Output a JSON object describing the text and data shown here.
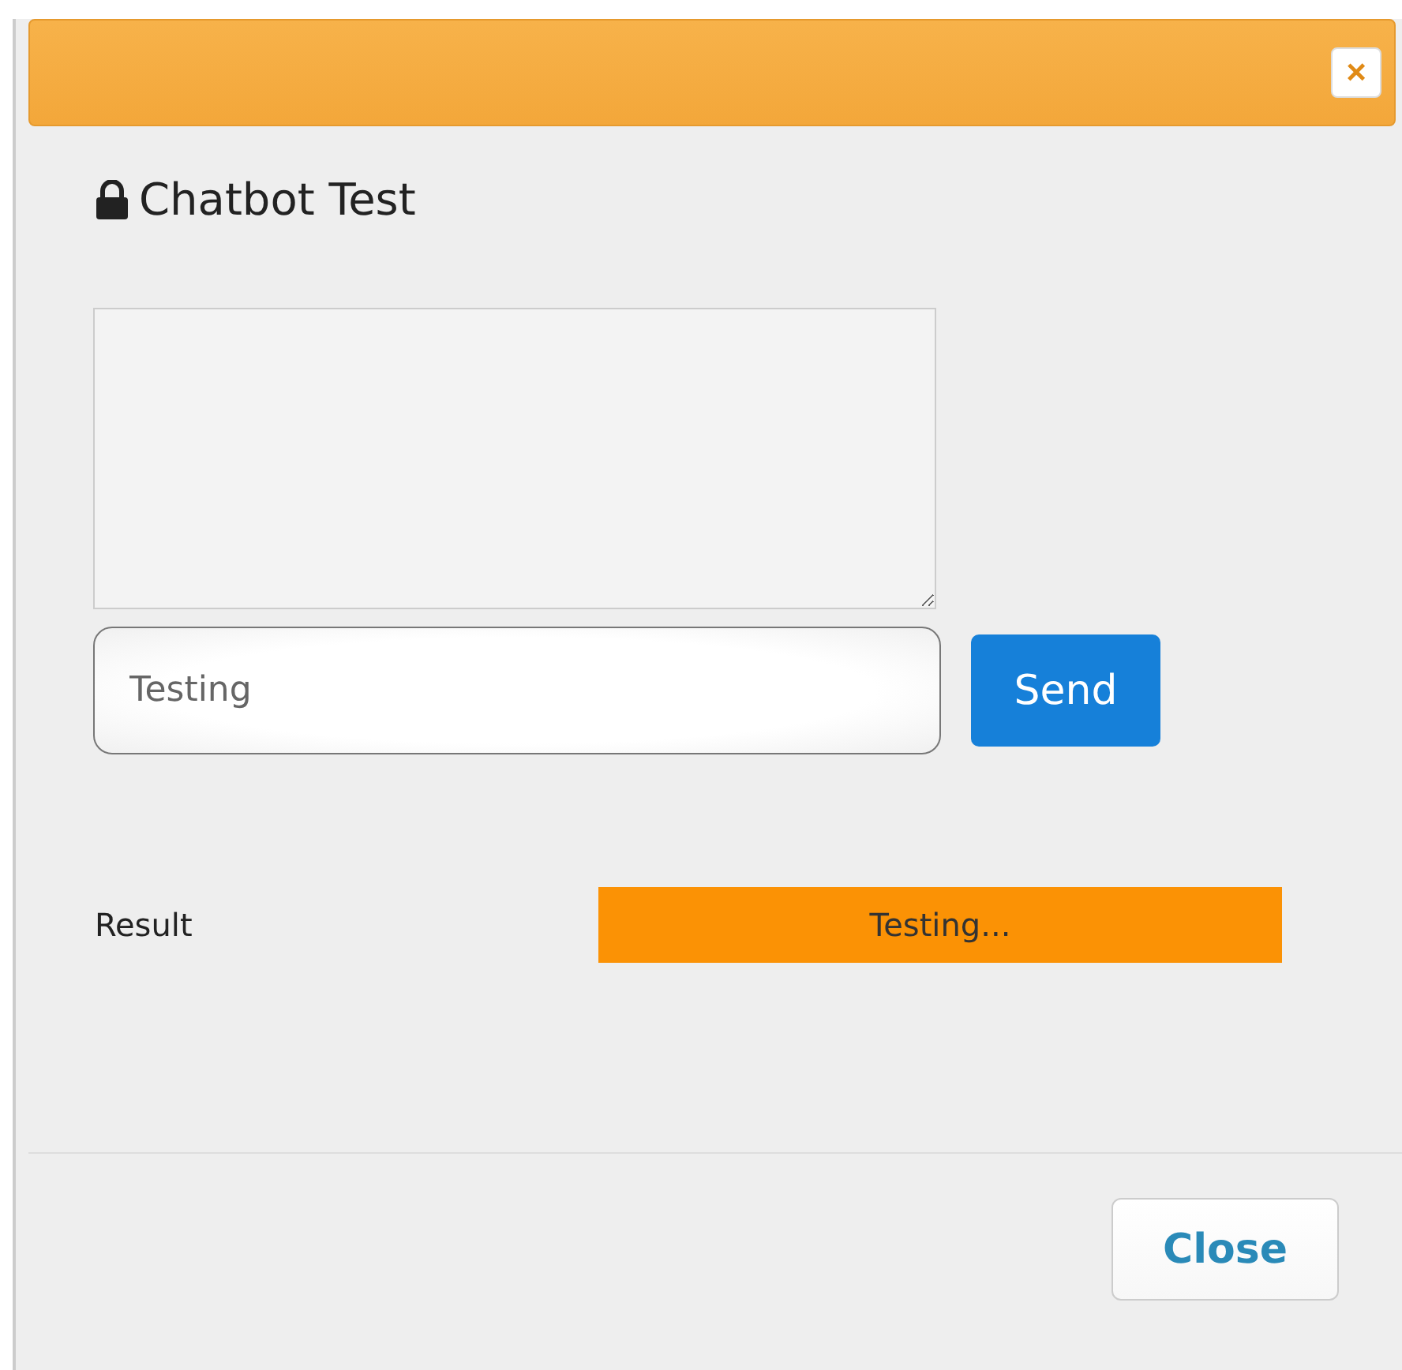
{
  "dialog": {
    "close_icon": "×",
    "title": "Chatbot Test"
  },
  "chat": {
    "message": "Testing",
    "send_button": "Send"
  },
  "result": {
    "label": "Result",
    "status": "Testing..."
  },
  "footer": {
    "close_button": "Close"
  }
}
